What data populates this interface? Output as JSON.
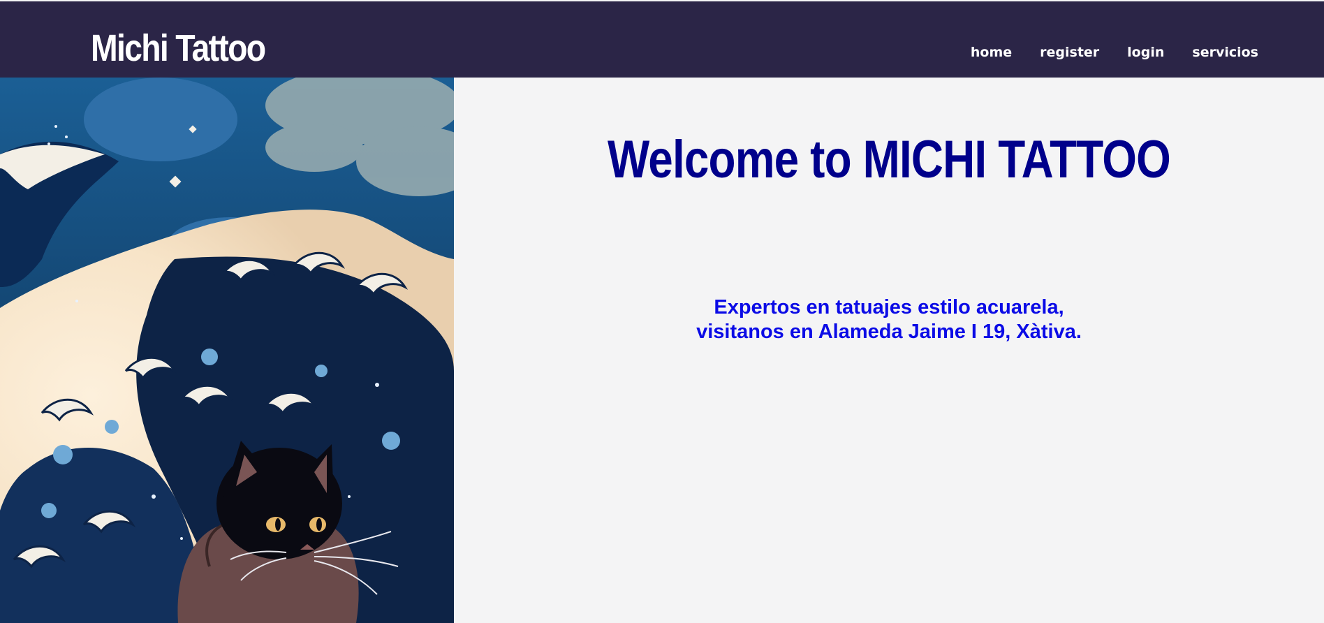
{
  "header": {
    "brand": "Michi Tattoo",
    "nav": [
      {
        "label": "home"
      },
      {
        "label": "register"
      },
      {
        "label": "login"
      },
      {
        "label": "servicios"
      }
    ]
  },
  "main": {
    "title": "Welcome to MICHI TATTOO",
    "subtitle": "Expertos en tatuajes estilo acuarela, visitanos en Alameda Jaime I 19, Xàtiva."
  },
  "colors": {
    "navbar": "#2b2547",
    "title": "#00008b",
    "subtitle": "#0b0be6",
    "background": "#f4f4f5"
  }
}
